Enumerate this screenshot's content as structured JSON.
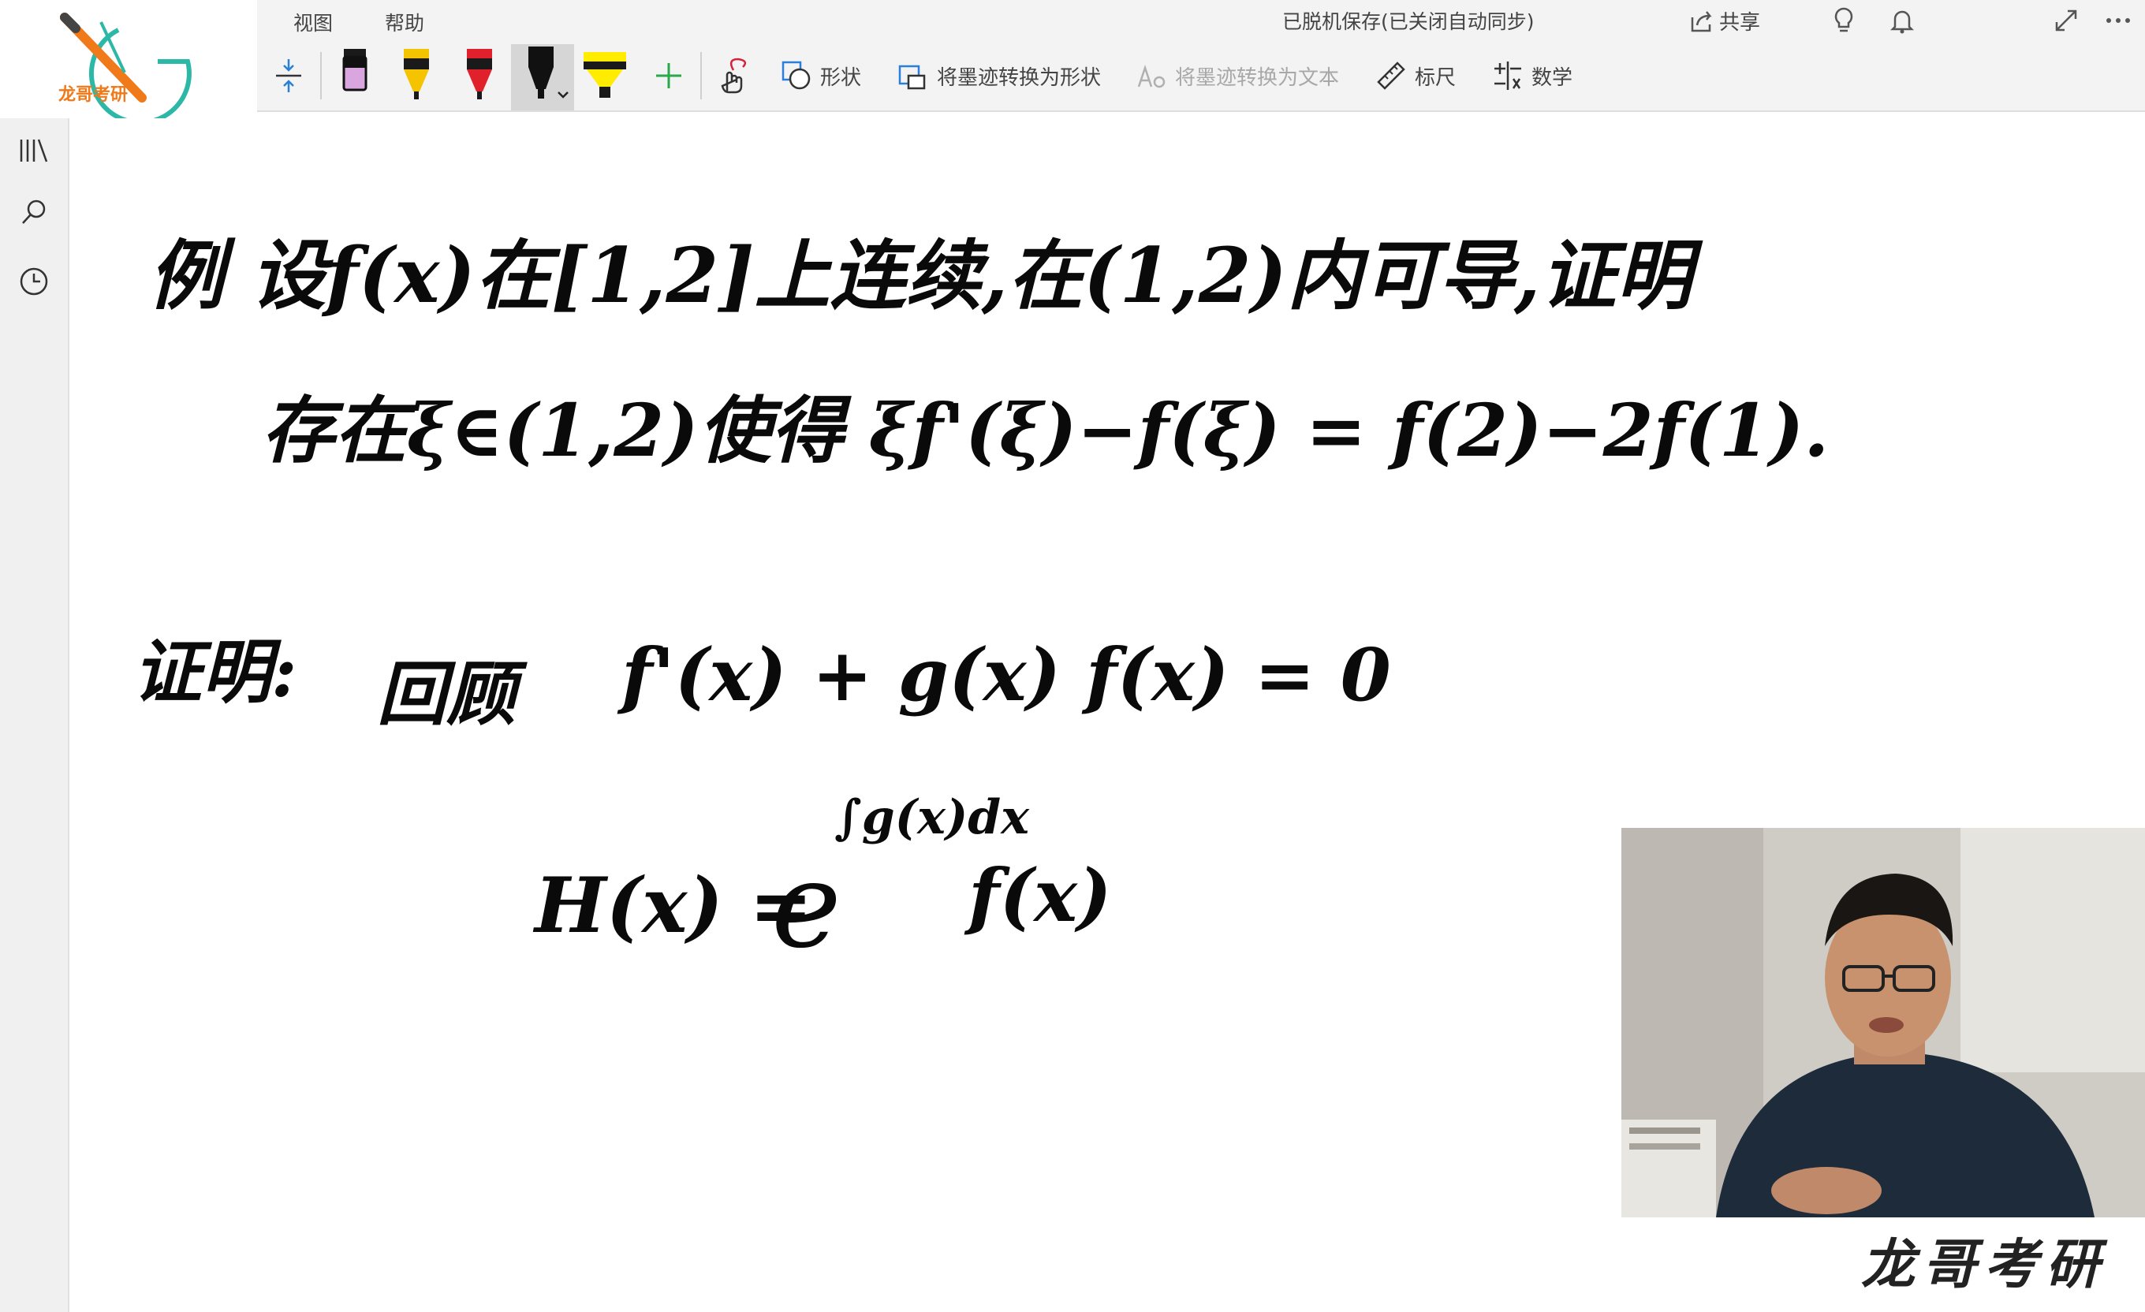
{
  "logo": {
    "text": "龙哥考研"
  },
  "menu": [
    "视图",
    "帮助"
  ],
  "status": {
    "save_text": "已脱机保存(已关闭自动同步)",
    "share_label": "共享"
  },
  "top_icons": [
    "lightbulb-icon",
    "bell-icon",
    "share-icon",
    "expand-icon",
    "more-icon"
  ],
  "toolbar": {
    "shape_label": "形状",
    "ink_to_shape_label": "将墨迹转换为形状",
    "ink_to_text_label": "将墨迹转换为文本",
    "ruler_label": "标尺",
    "math_label": "数学"
  },
  "pens": [
    {
      "name": "black-pen",
      "tip": "#1a1a1a",
      "body": "#d9a6e0"
    },
    {
      "name": "yellow-pen",
      "tip": "#f5c400",
      "body": "#1a1a1a"
    },
    {
      "name": "red-pen",
      "tip": "#e0202a",
      "body": "#1a1a1a"
    },
    {
      "name": "black-marker",
      "tip": "#111111",
      "body": "#111111"
    },
    {
      "name": "yellow-highlighter",
      "tip": "#ffec00",
      "body": "#1a1a1a"
    }
  ],
  "notes": {
    "line1": "例  设f(x)在[1,2]上连续,在(1,2)内可导,证明",
    "line2": "存在ξ∈(1,2)使得  ξf'(ξ)−f(ξ) = f(2)−2f(1).",
    "proof_label": "证明:",
    "recall_label": "回顾",
    "recall_formula": "f'(x) + g(x) f(x) = 0",
    "h_lhs": "H(x) =",
    "h_base": "e",
    "h_exponent": "∫g(x)dx",
    "h_factor": "f(x)"
  },
  "watermark": "龙哥考研"
}
